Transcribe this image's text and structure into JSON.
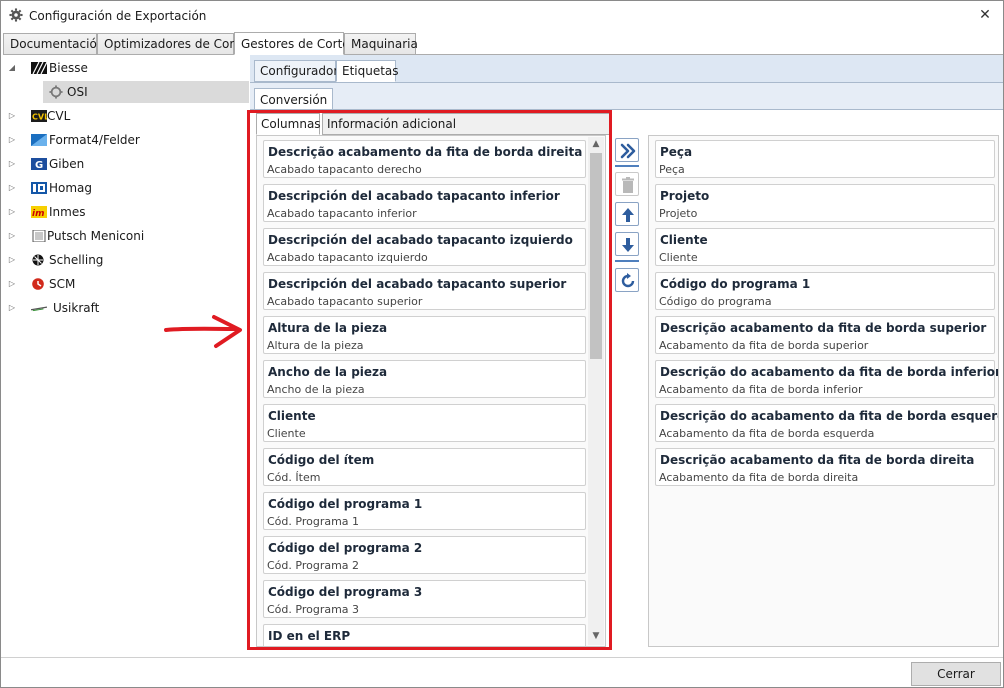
{
  "window": {
    "title": "Configuración de Exportación",
    "close_glyph": "✕",
    "icon": "gear-icon"
  },
  "main_tabs": [
    {
      "label": "Documentación"
    },
    {
      "label": "Optimizadores de Corte"
    },
    {
      "label": "Gestores de Corte",
      "active": true
    },
    {
      "label": "Maquinaria"
    }
  ],
  "tree": [
    {
      "label": "Biesse",
      "expanded": true,
      "logo": "biesse-logo"
    },
    {
      "label": "OSI",
      "child": true,
      "selected": true,
      "logo": "gear-icon"
    },
    {
      "label": "CVL",
      "logo": "cvl-logo"
    },
    {
      "label": "Format4/Felder",
      "logo": "format4-logo"
    },
    {
      "label": "Giben",
      "logo": "giben-logo"
    },
    {
      "label": "Homag",
      "logo": "homag-logo"
    },
    {
      "label": "Inmes",
      "logo": "inmes-logo"
    },
    {
      "label": "Putsch Meniconi",
      "logo": "putsch-logo"
    },
    {
      "label": "Schelling",
      "logo": "schelling-logo"
    },
    {
      "label": "SCM",
      "logo": "scm-logo"
    },
    {
      "label": "Usikraft",
      "logo": "usikraft-logo"
    }
  ],
  "sub_tabs": [
    {
      "label": "Configurador"
    },
    {
      "label": "Etiquetas",
      "active": true
    }
  ],
  "conversion_tab": {
    "label": "Conversión"
  },
  "columns_tabs": [
    {
      "label": "Columnas",
      "active": true
    },
    {
      "label": "Información adicional"
    }
  ],
  "available_columns": [
    {
      "title": "Descrição acabamento da fita de borda direita",
      "subtitle": "Acabado tapacanto derecho"
    },
    {
      "title": "Descripción del acabado tapacanto inferior",
      "subtitle": "Acabado tapacanto inferior"
    },
    {
      "title": "Descripción del acabado tapacanto izquierdo",
      "subtitle": "Acabado tapacanto izquierdo"
    },
    {
      "title": "Descripción del acabado tapacanto superior",
      "subtitle": "Acabado tapacanto superior"
    },
    {
      "title": "Altura de la pieza",
      "subtitle": "Altura de la pieza"
    },
    {
      "title": "Ancho de la pieza",
      "subtitle": "Ancho de la pieza"
    },
    {
      "title": "Cliente",
      "subtitle": "Cliente"
    },
    {
      "title": "Código del ítem",
      "subtitle": "Cód. Ítem"
    },
    {
      "title": "Código del programa 1",
      "subtitle": "Cód. Programa 1"
    },
    {
      "title": "Código del programa 2",
      "subtitle": "Cód. Programa 2"
    },
    {
      "title": "Código del programa 3",
      "subtitle": "Cód. Programa 3"
    },
    {
      "title": "ID en el ERP",
      "subtitle": ""
    }
  ],
  "selected_columns": [
    {
      "title": "Peça",
      "subtitle": "Peça"
    },
    {
      "title": "Projeto",
      "subtitle": "Projeto"
    },
    {
      "title": "Cliente",
      "subtitle": "Cliente"
    },
    {
      "title": "Código do programa 1",
      "subtitle": "Código do programa"
    },
    {
      "title": "Descrição acabamento da fita de borda superior",
      "subtitle": "Acabamento da fita de borda superior"
    },
    {
      "title": "Descrição do acabamento da fita de borda inferior",
      "subtitle": "Acabamento da fita de borda inferior"
    },
    {
      "title": "Descrição do acabamento da fita de borda esquerda",
      "subtitle": "Acabamento da fita de borda esquerda"
    },
    {
      "title": "Descrição acabamento da fita de borda direita",
      "subtitle": "Acabamento da fita de borda direita"
    }
  ],
  "toolbar": {
    "add_icon": "double-chevron-right-icon",
    "delete_icon": "trash-icon",
    "up_icon": "arrow-up-icon",
    "down_icon": "arrow-down-icon",
    "reset_icon": "refresh-icon"
  },
  "footer": {
    "close_label": "Cerrar"
  },
  "colors": {
    "accent": "#2e5d9e",
    "highlight": "#e01b22",
    "panel": "#dde7f3"
  }
}
